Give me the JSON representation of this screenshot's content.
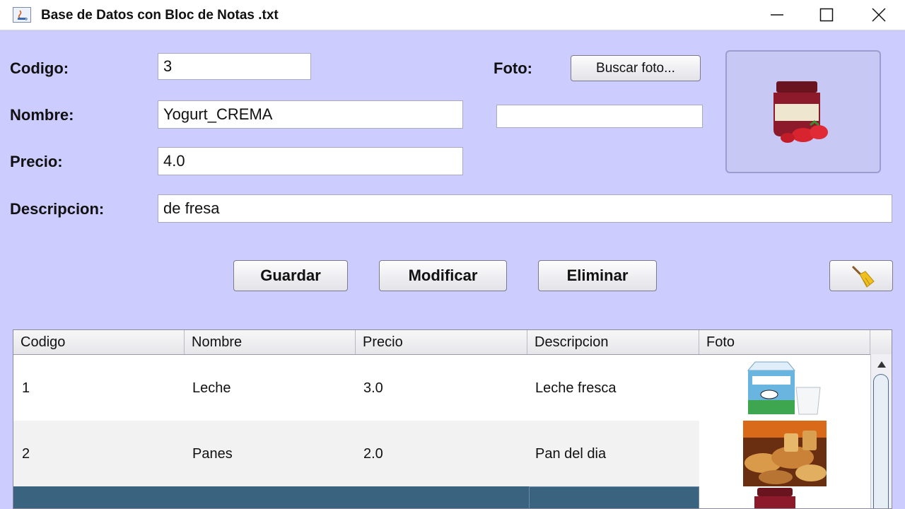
{
  "window": {
    "title": "Base de Datos con Bloc de Notas .txt"
  },
  "form": {
    "codigo_label": "Codigo:",
    "codigo_value": "3",
    "nombre_label": "Nombre:",
    "nombre_value": "Yogurt_CREMA",
    "precio_label": "Precio:",
    "precio_value": "4.0",
    "descripcion_label": "Descripcion:",
    "descripcion_value": "de fresa",
    "foto_label": "Foto:",
    "foto_path_value": "",
    "buscar_foto_label": "Buscar foto..."
  },
  "buttons": {
    "guardar": "Guardar",
    "modificar": "Modificar",
    "eliminar": "Eliminar",
    "clear_icon": "broom-icon"
  },
  "table": {
    "columns": [
      "Codigo",
      "Nombre",
      "Precio",
      "Descripcion",
      "Foto"
    ],
    "rows": [
      {
        "codigo": "1",
        "nombre": "Leche",
        "precio": "3.0",
        "descripcion": "Leche fresca",
        "foto": "milk-carton-icon"
      },
      {
        "codigo": "2",
        "nombre": "Panes",
        "precio": "2.0",
        "descripcion": "Pan del dia",
        "foto": "bread-icon"
      },
      {
        "codigo": "",
        "nombre": "",
        "precio": "",
        "descripcion": "",
        "foto": "jam-jar-icon"
      }
    ],
    "selected_row": 3
  },
  "colors": {
    "background": "#ccccff",
    "selection": "#39637f",
    "alt_row": "#f2f2f2"
  }
}
